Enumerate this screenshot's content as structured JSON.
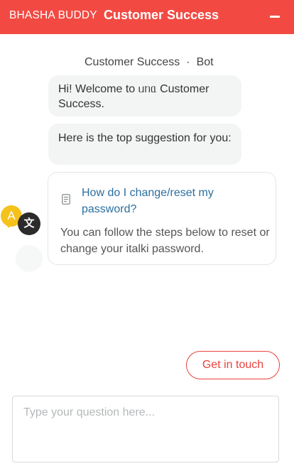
{
  "colors": {
    "brand": "#f24a43",
    "accent": "#e8423c",
    "link": "#2b6f9f"
  },
  "header": {
    "brand_name": "BHASHA BUDDY",
    "title": "Customer Success",
    "minimize_icon": "minimize-icon"
  },
  "chat": {
    "sender_name": "Customer Success",
    "sender_separator": "·",
    "sender_role": "Bot",
    "messages": [
      "Hi! Welcome to ᥙᥒᥲ Customer Success.",
      "Here is the top suggestion for you:"
    ],
    "suggestion": {
      "icon": "document-icon",
      "question": "How do I change/reset my password?",
      "answer": "You can follow the steps below to reset or change your italki password."
    }
  },
  "translator": {
    "source_letter": "A",
    "target_letter": "文"
  },
  "actions": {
    "get_in_touch": "Get in touch"
  },
  "composer": {
    "placeholder": "Type your question here..."
  }
}
